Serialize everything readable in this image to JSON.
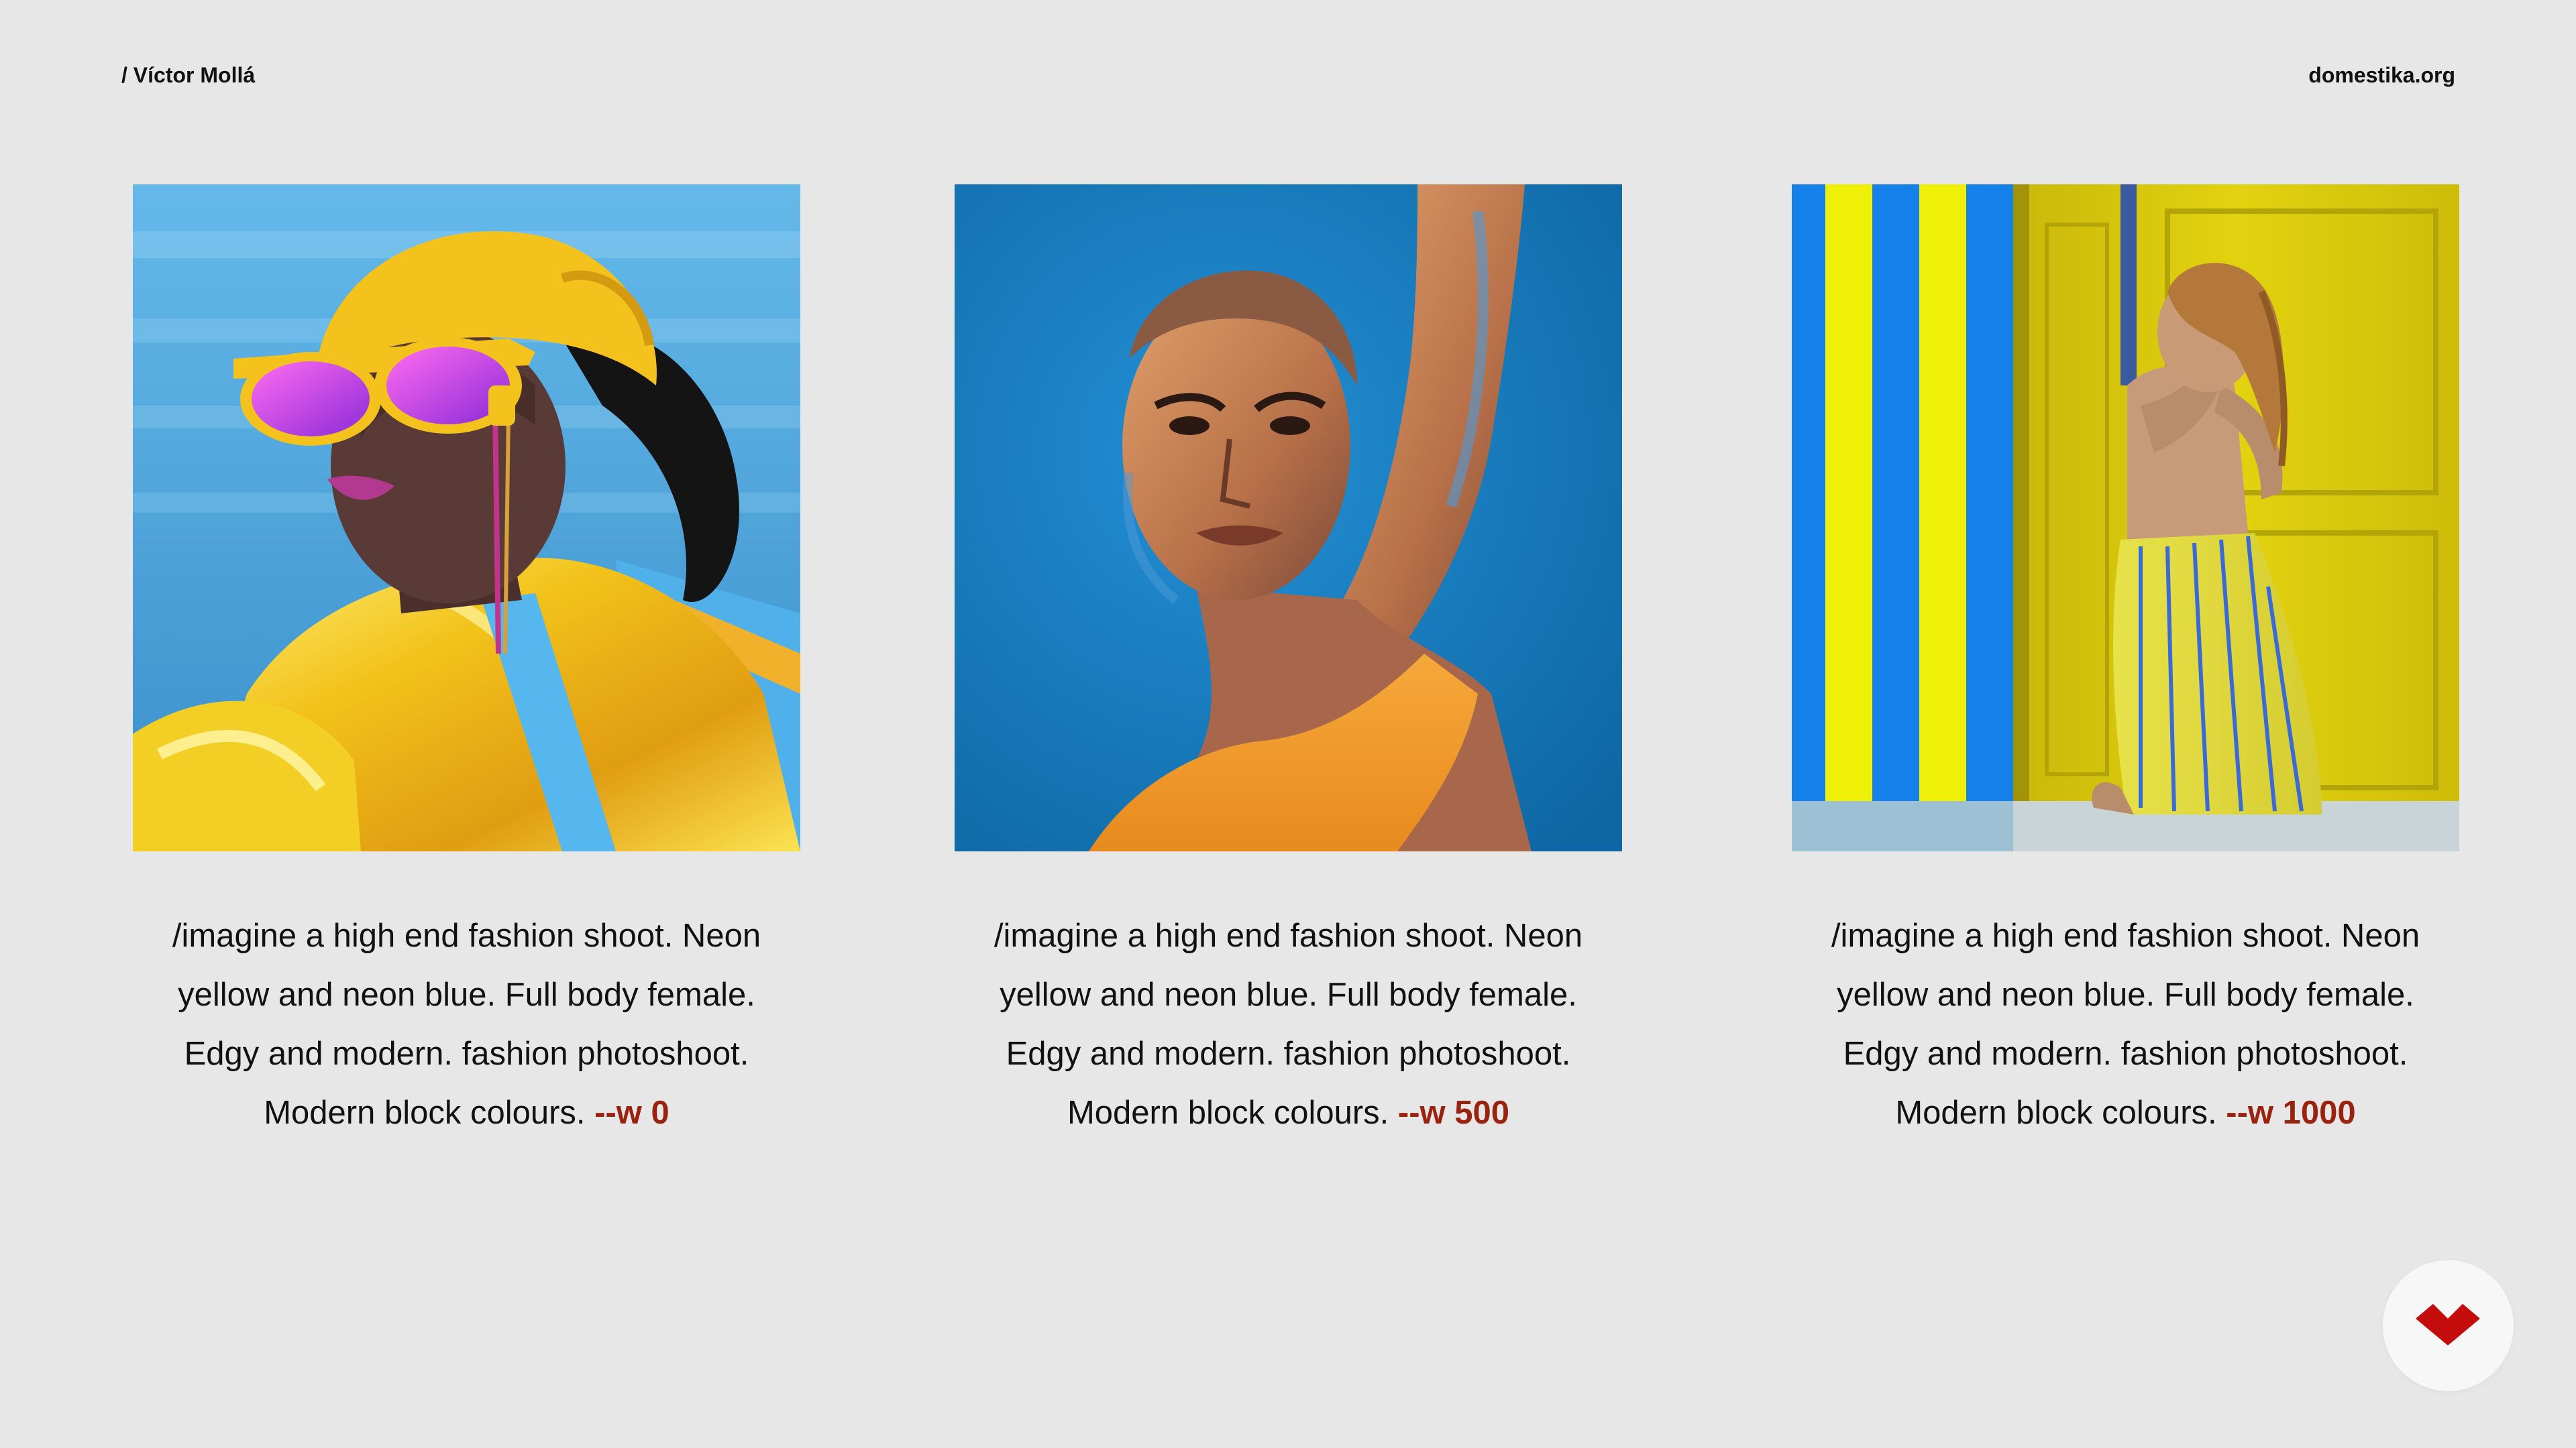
{
  "header": {
    "author": "/ Víctor Mollá",
    "site": "domestika.org"
  },
  "cards": [
    {
      "image_alt": "Neon fashion portrait of a woman in yellow headscarf, magenta mirrored sunglasses and glossy yellow jacket on blue background",
      "prompt": "/imagine a high end fashion shoot. Neon yellow and neon blue. Full body female. Edgy and modern. fashion photoshoot. Modern block colours.",
      "param": "--w 0"
    },
    {
      "image_alt": "Woman with shaved head raising her arm against a saturated blue background, wearing an orange top",
      "prompt": "/imagine a high end fashion shoot. Neon yellow and neon blue. Full body female. Edgy and modern. fashion photoshoot. Modern block colours.",
      "param": "--w 500"
    },
    {
      "image_alt": "Woman crouching beside a yellow door next to yellow and blue vertical stripes, wearing striped trousers",
      "prompt": "/imagine a high end fashion shoot. Neon yellow and neon blue. Full body female. Edgy and modern. fashion photoshoot. Modern block colours.",
      "param": "--w 1000"
    }
  ],
  "logo": {
    "icon": "domestika-logo-icon",
    "color": "#c40c0c"
  },
  "colors": {
    "background": "#e7e7e7",
    "param_accent": "#9a2310",
    "neon_yellow": "#f0e300",
    "neon_blue": "#1a7fe0"
  }
}
